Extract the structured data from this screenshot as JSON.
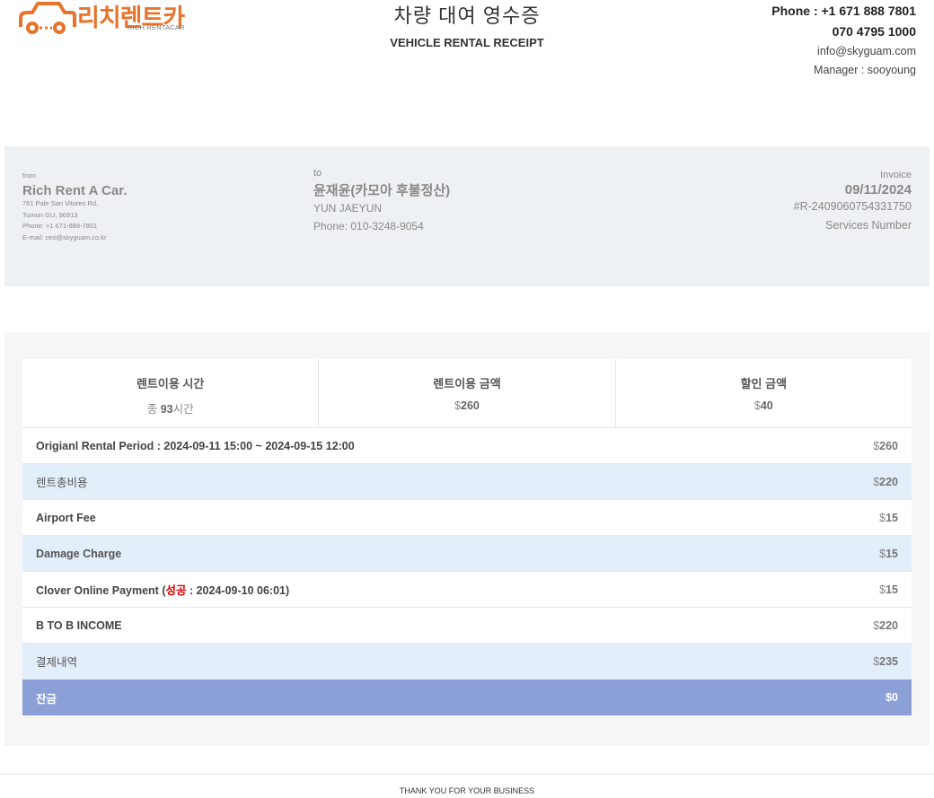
{
  "brand": {
    "logo_ko": "리치렌트카",
    "logo_en": "RICH RENTACAR",
    "accent_color": "#e8742c"
  },
  "title": {
    "ko": "차량 대여 영수증",
    "en": "VEHICLE RENTAL RECEIPT"
  },
  "contact": {
    "phone": "Phone : +1 671 888 7801",
    "phone2": "070 4795 1000",
    "email": "info@skyguam.com",
    "manager": "Manager : sooyoung"
  },
  "from": {
    "label": "from",
    "name": "Rich Rent A Car.",
    "address1": "761 Pale San Vitores Rd,",
    "address2": "Tumon GU, 96913",
    "phone": "Phone: +1 671-888-7801",
    "email": "E-mail: ceo@skyguam.co.kr"
  },
  "to": {
    "label": "to",
    "name": "윤재윤(카모아 후불정산)",
    "name_en": "YUN JAEYUN",
    "phone": "Phone: 010-3248-9054"
  },
  "invoice": {
    "label": "Invoice",
    "date": "09/11/2024",
    "number": "#R-2409060754331750",
    "services": "Services Number"
  },
  "summary": {
    "hours_label": "렌트이용 시간",
    "hours_prefix": "종 ",
    "hours_value": "93",
    "hours_suffix": "시간",
    "amount_label": "렌트이용 금액",
    "amount_currency": "$",
    "amount_value": "260",
    "discount_label": "할인 금액",
    "discount_currency": "$",
    "discount_value": "40"
  },
  "rows": {
    "original_label": "Origianl Rental Period : 2024-09-11 15:00 ~ 2024-09-15 12:00",
    "original_amount": "260",
    "total_cost_label": "렌트총비용",
    "total_cost_amount": "220",
    "airport_label": "Airport Fee",
    "airport_amount": "15",
    "damage_label": "Damage Charge",
    "damage_amount": "15",
    "clover_prefix": "Clover Online Payment (",
    "clover_status": "성공",
    "clover_suffix": " : 2024-09-10 06:01)",
    "clover_amount": "15",
    "b2b_label": "B TO B INCOME",
    "b2b_amount": "220",
    "payment_label": "결제내역",
    "payment_amount": "235",
    "balance_label": "잔금",
    "balance_amount": "0",
    "currency": "$"
  },
  "footer": {
    "text": "THANK YOU FOR YOUR BUSINESS"
  }
}
